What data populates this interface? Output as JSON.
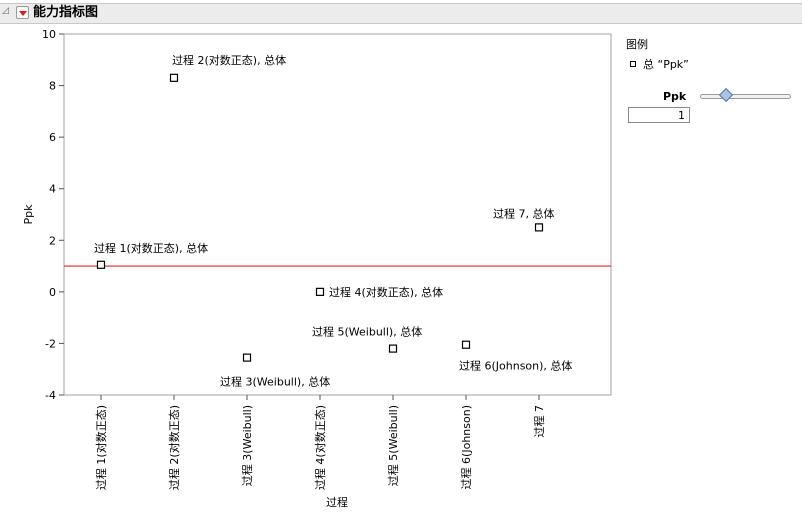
{
  "outline": {
    "title": "能力指标图"
  },
  "legend": {
    "title": "图例",
    "items": [
      {
        "label": "总 “Ppk”"
      }
    ]
  },
  "ppk_control": {
    "label": "Ppk",
    "value": "1"
  },
  "chart_data": {
    "type": "scatter",
    "title": "",
    "xlabel": "过程",
    "ylabel": "Ppk",
    "ylim": [
      -4,
      10
    ],
    "yticks": [
      -4,
      -2,
      0,
      2,
      4,
      6,
      8,
      10
    ],
    "categories": [
      "过程 1(对数正态)",
      "过程 2(对数正态)",
      "过程 3(Weibull)",
      "过程 4(对数正态)",
      "过程 5(Weibull)",
      "过程 6(Johnson)",
      "过程 7"
    ],
    "reference_line": {
      "y": 1,
      "color": "#d9262d"
    },
    "marker_color": "#000000",
    "points": [
      {
        "x": "过程 1(对数正态)",
        "y": 1.05,
        "label": "过程 1(对数正态), 总体"
      },
      {
        "x": "过程 2(对数正态)",
        "y": 8.3,
        "label": "过程 2(对数正态), 总体"
      },
      {
        "x": "过程 3(Weibull)",
        "y": -2.55,
        "label": "过程 3(Weibull), 总体"
      },
      {
        "x": "过程 4(对数正态)",
        "y": 0,
        "label": "过程 4(对数正态), 总体"
      },
      {
        "x": "过程 5(Weibull)",
        "y": -2.2,
        "label": "过程 5(Weibull), 总体"
      },
      {
        "x": "过程 6(Johnson)",
        "y": -2.05,
        "label": "过程 6(Johnson), 总体"
      },
      {
        "x": "过程 7",
        "y": 2.5,
        "label": "过程 7, 总体"
      }
    ]
  }
}
